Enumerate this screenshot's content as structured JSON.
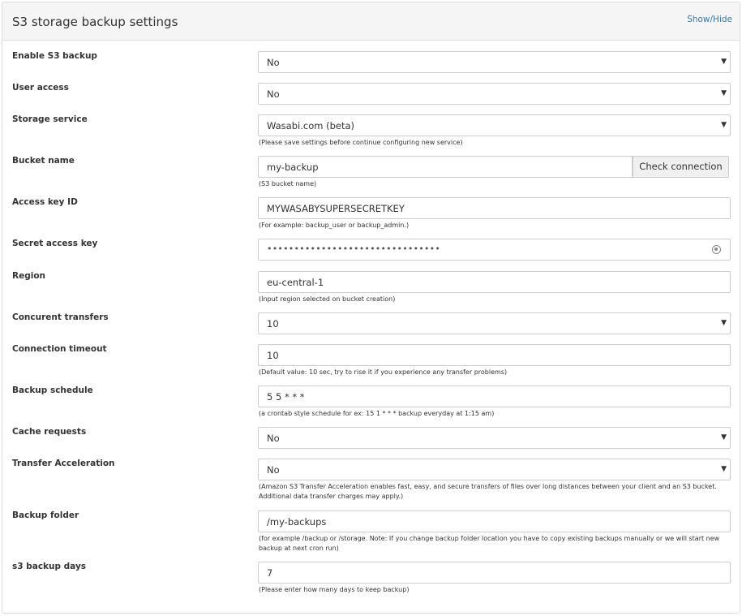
{
  "panel": {
    "title": "S3 storage backup settings",
    "toggle_label": "Show/Hide"
  },
  "fields": {
    "enable_s3": {
      "label": "Enable S3 backup",
      "value": "No"
    },
    "user_access": {
      "label": "User access",
      "value": "No"
    },
    "storage_service": {
      "label": "Storage service",
      "value": "Wasabi.com (beta)",
      "help": "(Please save settings before continue configuring new service)"
    },
    "bucket_name": {
      "label": "Bucket name",
      "value": "my-backup",
      "button": "Check connection",
      "help": "(S3 bucket name)"
    },
    "access_key_id": {
      "label": "Access key ID",
      "value": "MYWASABYSUPERSECRETKEY",
      "help": "(For example: backup_user or backup_admin.)"
    },
    "secret_access_key": {
      "label": "Secret access key",
      "value": "••••••••••••••••••••••••••••••••"
    },
    "region": {
      "label": "Region",
      "value": "eu-central-1",
      "help": "(Input region selected on bucket creation)"
    },
    "concurrent_transfers": {
      "label": "Concurent transfers",
      "value": "10"
    },
    "connection_timeout": {
      "label": "Connection timeout",
      "value": "10",
      "help": "(Default value: 10 sec, try to rise it if you experience any transfer problems)"
    },
    "backup_schedule": {
      "label": "Backup schedule",
      "value": "5 5 * * *",
      "help": "(a crontab style schedule for ex: 15 1 * * * backup everyday at 1:15 am)"
    },
    "cache_requests": {
      "label": "Cache requests",
      "value": "No"
    },
    "transfer_acceleration": {
      "label": "Transfer Acceleration",
      "value": "No",
      "help": "(Amazon S3 Transfer Acceleration enables fast, easy, and secure transfers of files over long distances between your client and an S3 bucket. Additional data transfer charges may apply.)"
    },
    "backup_folder": {
      "label": "Backup folder",
      "value": "/my-backups",
      "help": "(for example /backup or /storage. Note: If you change backup folder location you have to copy existing backups manually or we will start new backup at next cron run)"
    },
    "s3_backup_days": {
      "label": "s3 backup days",
      "value": "7",
      "help": "(Please enter how many days to keep backup)"
    }
  }
}
